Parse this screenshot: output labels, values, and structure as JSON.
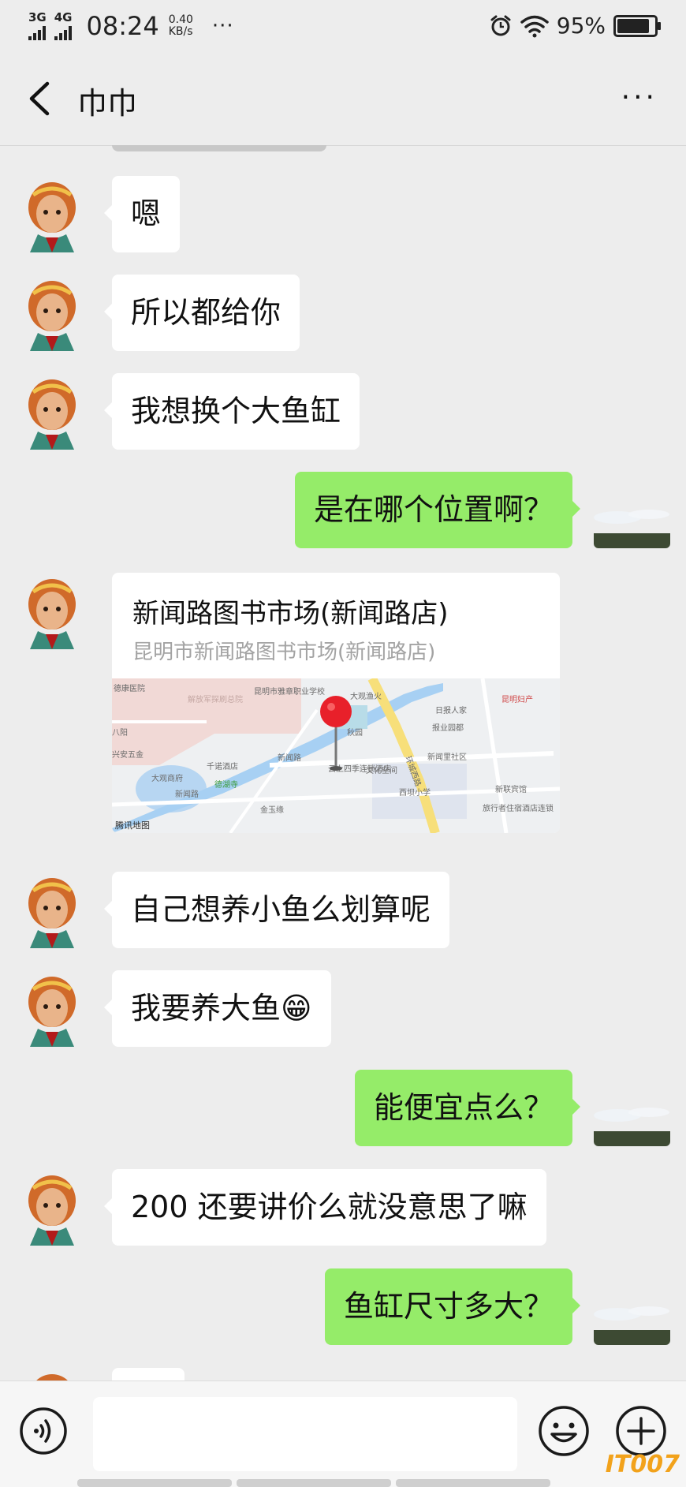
{
  "status_bar": {
    "net1": "3G",
    "net2": "4G",
    "time": "08:24",
    "speed_value": "0.40",
    "speed_unit": "KB/s",
    "dots": "···",
    "battery_pct": "95%",
    "battery_level": 0.95
  },
  "header": {
    "title": "巾巾",
    "more": "···"
  },
  "messages": [
    {
      "side": "in",
      "text": "嗯"
    },
    {
      "side": "in",
      "text": "所以都给你"
    },
    {
      "side": "in",
      "text": "我想换个大鱼缸"
    },
    {
      "side": "out",
      "text": "是在哪个位置啊？"
    },
    {
      "side": "in",
      "type": "location"
    },
    {
      "side": "in",
      "text": "自己想养小鱼么划算呢"
    },
    {
      "side": "in",
      "text": "我要养大鱼😁"
    },
    {
      "side": "out",
      "text": "能便宜点么？"
    },
    {
      "side": "in",
      "text": "200 还要讲价么就没意思了嘛"
    },
    {
      "side": "out",
      "text": "鱼缸尺寸多大？"
    }
  ],
  "location": {
    "name": "新闻路图书市场(新闻路店)",
    "address": "昆明市新闻路图书市场(新闻路店)",
    "map_labels": {
      "hospital": "德康医院",
      "school": "昆明市雅章职业学校",
      "military": "解放军探刷总院",
      "fish": "大观渔火",
      "qiuyuan": "秋园",
      "sunrise": "日报人家",
      "baoye": "报业园都",
      "xinwenli": "新闻里社区",
      "yunshang": "云上四季连锁酒店",
      "culture": "文化空间",
      "daguan": "大观商府",
      "qiannuo": "千诺酒店",
      "temple": "德湖寺",
      "xinwenlu1": "新闻路",
      "xinwenlu2": "新闻路",
      "huancheng": "环城西路",
      "xiba": "西坝小学",
      "xinlian": "新联宾馆",
      "jinyu": "金玉缘",
      "travel": "旅行者住宿酒店连锁",
      "xingan": "兴安五金",
      "kunming_fu": "昆明妇产",
      "bahe": "八阳",
      "logo": "腾讯地图"
    }
  },
  "composer": {
    "placeholder": ""
  },
  "watermark": "IT007",
  "colors": {
    "background": "#ededed",
    "outgoing_bubble": "#95ec69",
    "incoming_bubble": "#ffffff",
    "map_pin": "#e8202a"
  }
}
